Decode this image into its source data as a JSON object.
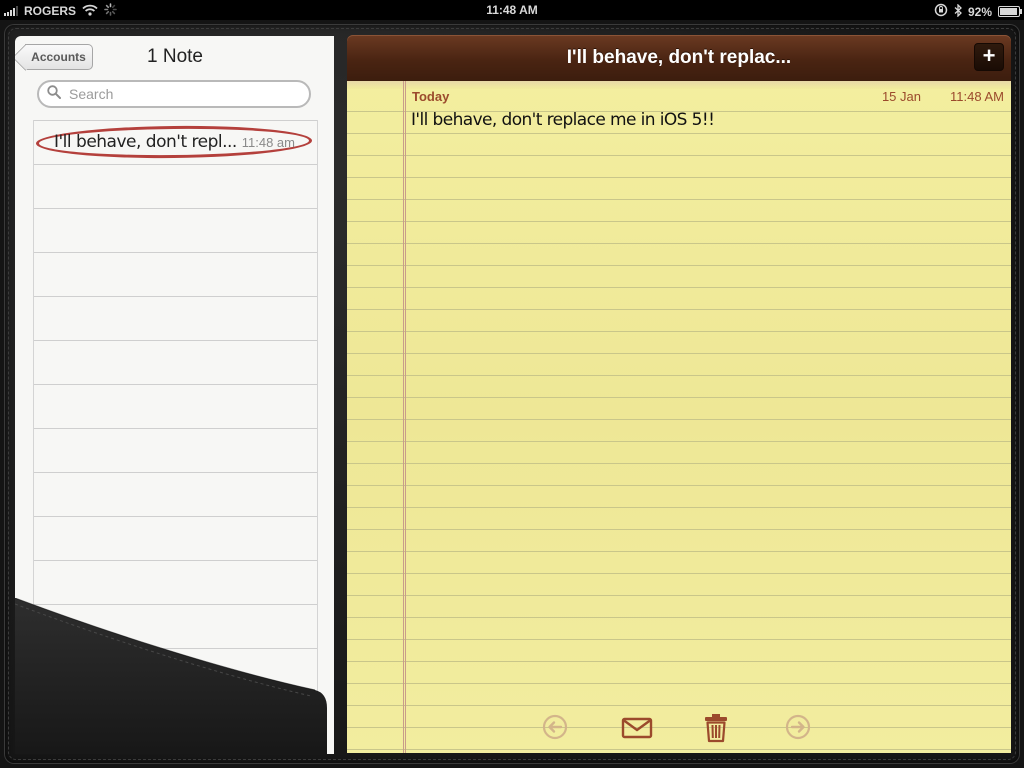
{
  "status_bar": {
    "carrier": "ROGERS",
    "time": "11:48 AM",
    "battery_percent": "92%",
    "battery_level": 0.92,
    "icons": [
      "signal-icon",
      "wifi-icon",
      "activity-spinner-icon",
      "rotation-lock-icon",
      "bluetooth-icon",
      "battery-icon"
    ]
  },
  "sidebar": {
    "back_label": "Accounts",
    "title": "1 Note",
    "search_placeholder": "Search",
    "notes": [
      {
        "title": "I'll behave, don't repl...",
        "time": "11:48 am",
        "selected": true
      }
    ]
  },
  "note": {
    "header_title": "I'll behave, don't replac...",
    "add_label": "+",
    "date_label": "Today",
    "date": "15 Jan",
    "time": "11:48 AM",
    "body": "I'll behave, don't replace me in iOS 5!!"
  },
  "toolbar": {
    "icons": [
      "previous-note-icon",
      "email-icon",
      "trash-icon",
      "next-note-icon"
    ]
  },
  "colors": {
    "paper": "#f1ec9c",
    "header_leather": "#4a2412",
    "accent_red": "#b4403c",
    "toolbar_icon": "#9b4a2c"
  }
}
